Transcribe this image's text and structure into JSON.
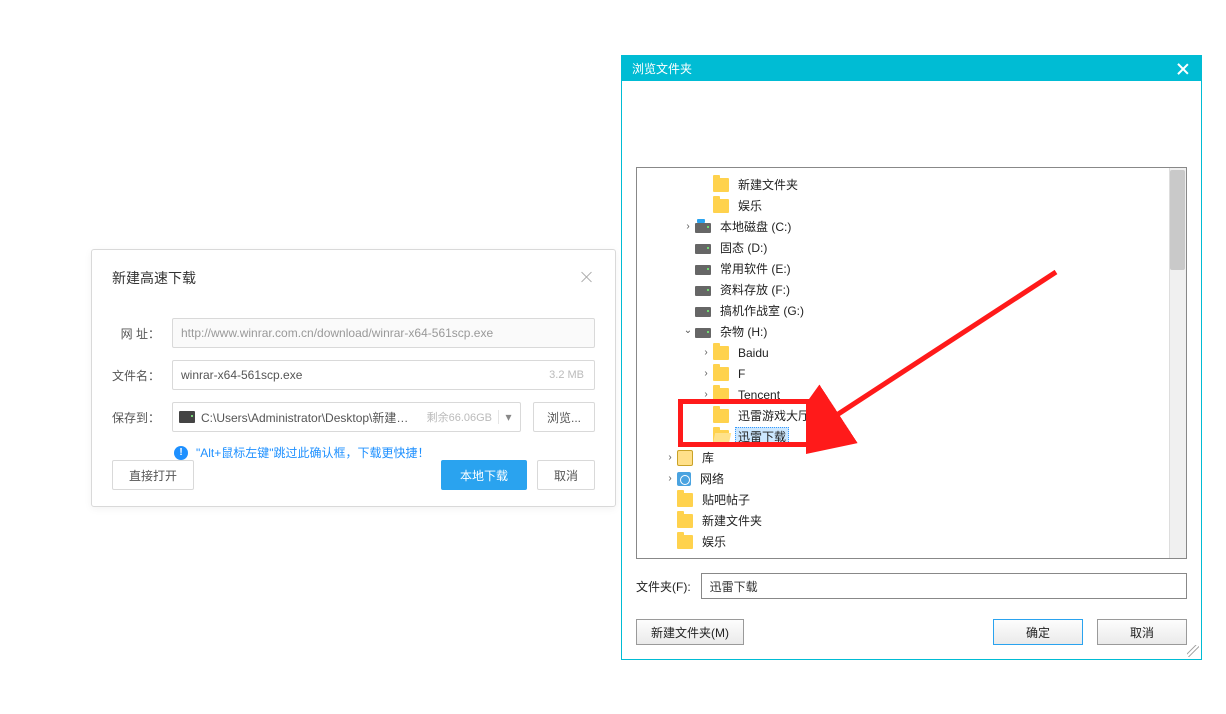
{
  "download_dialog": {
    "title": "新建高速下载",
    "labels": {
      "url": "网 址：",
      "filename": "文件名：",
      "saveto": "保存到："
    },
    "url": "http://www.winrar.com.cn/download/winrar-x64-561scp.exe",
    "filename": "winrar-x64-561scp.exe",
    "filesize": "3.2 MB",
    "save_path": "C:\\Users\\Administrator\\Desktop\\新建文...",
    "free_space": "剩余66.06GB",
    "browse_btn": "浏览...",
    "hint": "\"Alt+鼠标左键\"跳过此确认框，下载更快捷！",
    "buttons": {
      "open": "直接打开",
      "download": "本地下载",
      "cancel": "取消"
    }
  },
  "browse_dialog": {
    "title": "浏览文件夹",
    "folder_label": "文件夹(F):",
    "folder_value": "迅雷下载",
    "buttons": {
      "newfolder": "新建文件夹(M)",
      "ok": "确定",
      "cancel": "取消"
    },
    "tree": [
      {
        "indent": 3,
        "exp": "none",
        "icon": "folder",
        "label": "新建文件夹"
      },
      {
        "indent": 3,
        "exp": "none",
        "icon": "folder",
        "label": "娱乐"
      },
      {
        "indent": 2,
        "exp": "closed",
        "icon": "drive-os",
        "label": "本地磁盘 (C:)"
      },
      {
        "indent": 2,
        "exp": "none",
        "icon": "drive",
        "label": "固态 (D:)"
      },
      {
        "indent": 2,
        "exp": "none",
        "icon": "drive",
        "label": "常用软件 (E:)"
      },
      {
        "indent": 2,
        "exp": "none",
        "icon": "drive",
        "label": "资料存放 (F:)"
      },
      {
        "indent": 2,
        "exp": "none",
        "icon": "drive",
        "label": "搞机作战室 (G:)"
      },
      {
        "indent": 2,
        "exp": "open",
        "icon": "drive",
        "label": "杂物 (H:)"
      },
      {
        "indent": 3,
        "exp": "closed",
        "icon": "folder",
        "label": "Baidu"
      },
      {
        "indent": 3,
        "exp": "closed",
        "icon": "folder",
        "label": "F"
      },
      {
        "indent": 3,
        "exp": "closed",
        "icon": "folder",
        "label": "Tencent"
      },
      {
        "indent": 3,
        "exp": "none",
        "icon": "folder",
        "label": "迅雷游戏大厅"
      },
      {
        "indent": 3,
        "exp": "none",
        "icon": "folder-open",
        "label": "迅雷下载",
        "selected": true
      },
      {
        "indent": 1,
        "exp": "closed",
        "icon": "lib",
        "label": "库"
      },
      {
        "indent": 1,
        "exp": "closed",
        "icon": "net",
        "label": "网络"
      },
      {
        "indent": 1,
        "exp": "none",
        "icon": "folder",
        "label": "贴吧帖子"
      },
      {
        "indent": 1,
        "exp": "none",
        "icon": "folder",
        "label": "新建文件夹"
      },
      {
        "indent": 1,
        "exp": "none",
        "icon": "folder",
        "label": "娱乐"
      }
    ]
  }
}
